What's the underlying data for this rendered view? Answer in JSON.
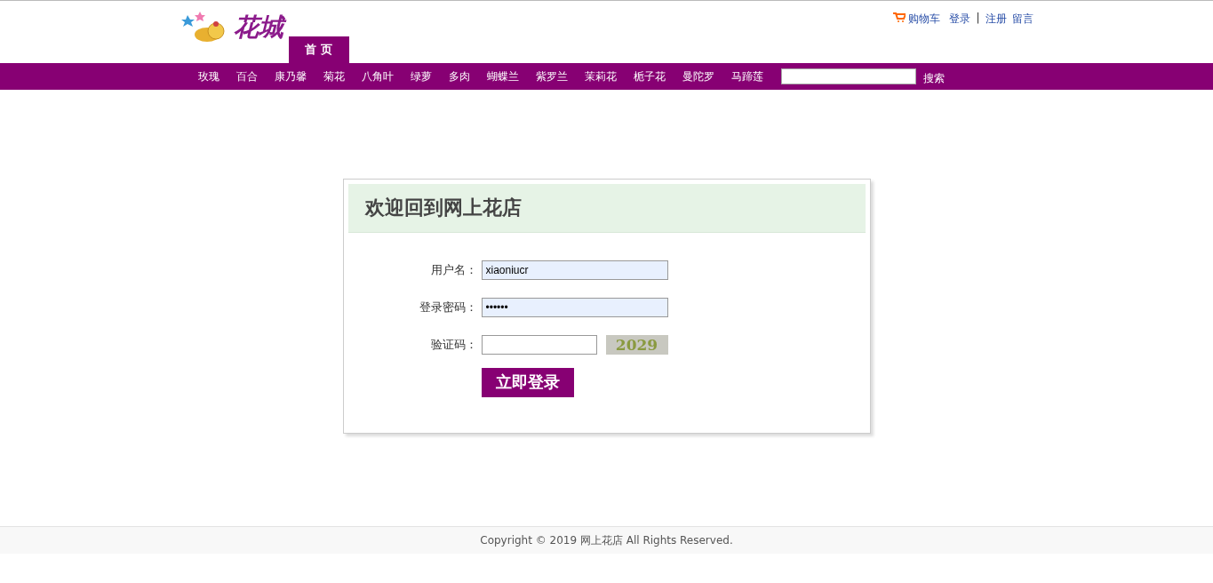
{
  "logo": {
    "text": "花城"
  },
  "home_tab": {
    "label": "首 页",
    "selected": true
  },
  "top_links": [
    {
      "kind": "cart",
      "label": "购物车"
    },
    {
      "kind": "link",
      "label": "登录"
    },
    {
      "kind": "separator",
      "label": "|"
    },
    {
      "kind": "link",
      "label": "注册"
    },
    {
      "kind": "link",
      "label": "留言"
    }
  ],
  "categories": [
    "玫瑰",
    "百合",
    "康乃馨",
    "菊花",
    "八角叶",
    "绿萝",
    "多肉",
    "蝴蝶兰",
    "紫罗兰",
    "茉莉花",
    "栀子花",
    "曼陀罗",
    "马蹄莲"
  ],
  "search": {
    "button": "搜索"
  },
  "login": {
    "title": "欢迎回到网上花店",
    "fields": [
      {
        "kind": "text",
        "label": "用户名：",
        "value": "xiaoniucr",
        "autofilled": true
      },
      {
        "kind": "password",
        "label": "登录密码：",
        "value": "••••••",
        "autofilled": true
      },
      {
        "kind": "captcha",
        "label": "验证码：",
        "captcha": "2029",
        "autofilled": false
      }
    ],
    "submit": "立即登录"
  },
  "footer": "Copyright © 2019 网上花店 All Rights Reserved."
}
